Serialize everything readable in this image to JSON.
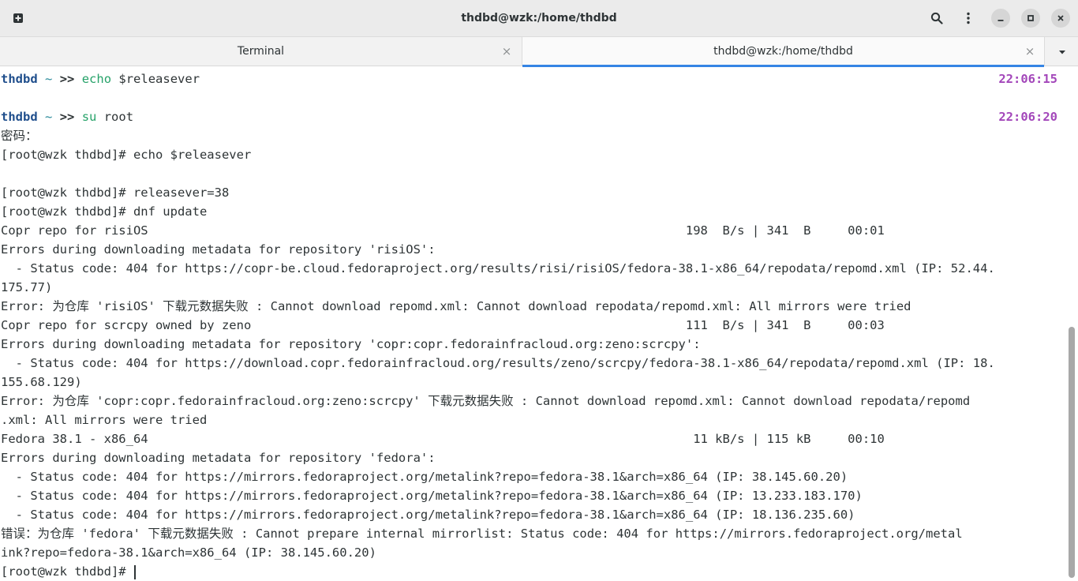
{
  "window": {
    "title": "thdbd@wzk:/home/thdbd"
  },
  "tabs": [
    {
      "label": "Terminal",
      "active": false
    },
    {
      "label": "thdbd@wzk:/home/thdbd",
      "active": true
    }
  ],
  "icons": {
    "new_tab": "new-tab-icon",
    "search": "search-icon",
    "menu": "kebab-menu-icon",
    "minimize": "minimize-icon",
    "maximize": "maximize-icon",
    "close": "close-icon",
    "tab_close": "×",
    "tabs_dropdown": "chevron-down-icon"
  },
  "colors": {
    "prompt_user": "#1f4e8c",
    "prompt_tilde": "#2a8a9a",
    "command": "#26a269",
    "timestamp": "#a347ba",
    "accent": "#3584e4"
  },
  "prompts": [
    {
      "user": "thdbd",
      "tilde": "~",
      "arrow": ">>",
      "cmd": "echo",
      "args": " $releasever",
      "time": "22:06:15"
    },
    {
      "user": "thdbd",
      "tilde": "~",
      "arrow": ">>",
      "cmd": "su",
      "args": " root",
      "time": "22:06:20"
    }
  ],
  "lines": [
    "密码：",
    "[root@wzk thdbd]# echo $releasever",
    "",
    "[root@wzk thdbd]# releasever=38",
    "[root@wzk thdbd]# dnf update",
    "Copr repo for risiOS                                                                         198  B/s | 341  B     00:01",
    "Errors during downloading metadata for repository 'risiOS':",
    "  - Status code: 404 for https://copr-be.cloud.fedoraproject.org/results/risi/risiOS/fedora-38.1-x86_64/repodata/repomd.xml (IP: 52.44.",
    "175.77)",
    "Error: 为仓库 'risiOS' 下载元数据失败 : Cannot download repomd.xml: Cannot download repodata/repomd.xml: All mirrors were tried",
    "Copr repo for scrcpy owned by zeno                                                           111  B/s | 341  B     00:03",
    "Errors during downloading metadata for repository 'copr:copr.fedorainfracloud.org:zeno:scrcpy':",
    "  - Status code: 404 for https://download.copr.fedorainfracloud.org/results/zeno/scrcpy/fedora-38.1-x86_64/repodata/repomd.xml (IP: 18.",
    "155.68.129)",
    "Error: 为仓库 'copr:copr.fedorainfracloud.org:zeno:scrcpy' 下载元数据失败 : Cannot download repomd.xml: Cannot download repodata/repomd",
    ".xml: All mirrors were tried",
    "Fedora 38.1 - x86_64                                                                          11 kB/s | 115 kB     00:10",
    "Errors during downloading metadata for repository 'fedora':",
    "  - Status code: 404 for https://mirrors.fedoraproject.org/metalink?repo=fedora-38.1&arch=x86_64 (IP: 38.145.60.20)",
    "  - Status code: 404 for https://mirrors.fedoraproject.org/metalink?repo=fedora-38.1&arch=x86_64 (IP: 13.233.183.170)",
    "  - Status code: 404 for https://mirrors.fedoraproject.org/metalink?repo=fedora-38.1&arch=x86_64 (IP: 18.136.235.60)",
    "错误：为仓库 'fedora' 下载元数据失败 : Cannot prepare internal mirrorlist: Status code: 404 for https://mirrors.fedoraproject.org/metal",
    "ink?repo=fedora-38.1&arch=x86_64 (IP: 38.145.60.20)"
  ],
  "current_prompt": "[root@wzk thdbd]# "
}
